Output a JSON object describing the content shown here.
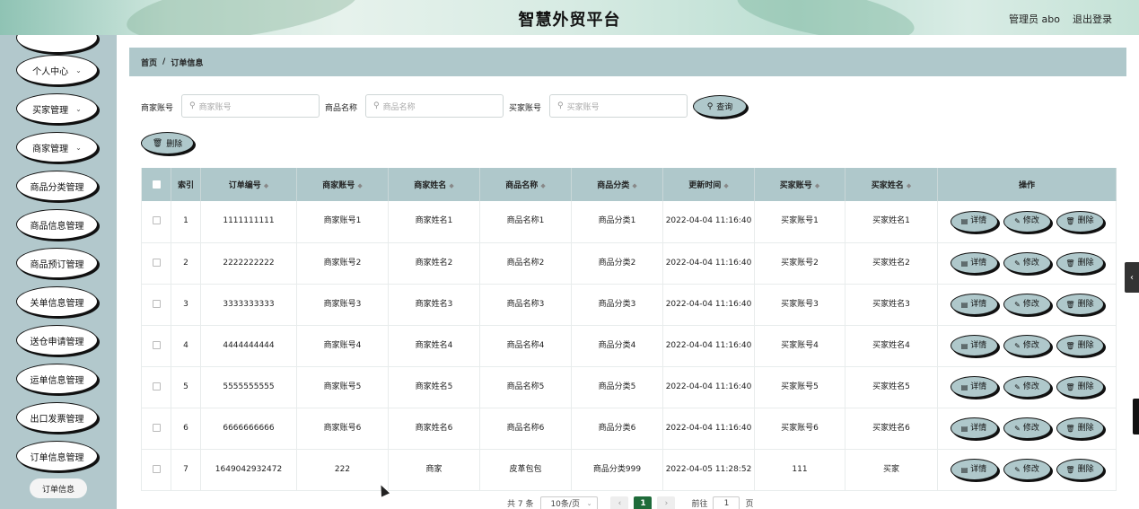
{
  "header": {
    "title": "智慧外贸平台",
    "user": "管理员 abo",
    "logout": "退出登录"
  },
  "sidebar": {
    "items": [
      {
        "label": "个人中心",
        "chevron": true
      },
      {
        "label": "买家管理",
        "chevron": true
      },
      {
        "label": "商家管理",
        "chevron": true
      },
      {
        "label": "商品分类管理"
      },
      {
        "label": "商品信息管理"
      },
      {
        "label": "商品预订管理"
      },
      {
        "label": "关单信息管理"
      },
      {
        "label": "送仓申请管理"
      },
      {
        "label": "运单信息管理"
      },
      {
        "label": "出口发票管理"
      },
      {
        "label": "订单信息管理"
      }
    ],
    "sub_item": "订单信息"
  },
  "breadcrumb": {
    "home": "首页",
    "sep": "/",
    "current": "订单信息"
  },
  "search": {
    "merchant_label": "商家账号",
    "merchant_placeholder": "商家账号",
    "product_label": "商品名称",
    "product_placeholder": "商品名称",
    "buyer_label": "买家账号",
    "buyer_placeholder": "买家账号",
    "query_button": "查询"
  },
  "toolbar": {
    "delete_button": "删除"
  },
  "table": {
    "columns": [
      "索引",
      "订单编号",
      "商家账号",
      "商家姓名",
      "商品名称",
      "商品分类",
      "更新时间",
      "买家账号",
      "买家姓名",
      "操作"
    ],
    "rows": [
      {
        "idx": "1",
        "order_no": "1111111111",
        "merchant_acc": "商家账号1",
        "merchant_name": "商家姓名1",
        "product": "商品名称1",
        "category": "商品分类1",
        "time": "2022-04-04 11:16:40",
        "buyer_acc": "买家账号1",
        "buyer_name": "买家姓名1"
      },
      {
        "idx": "2",
        "order_no": "2222222222",
        "merchant_acc": "商家账号2",
        "merchant_name": "商家姓名2",
        "product": "商品名称2",
        "category": "商品分类2",
        "time": "2022-04-04 11:16:40",
        "buyer_acc": "买家账号2",
        "buyer_name": "买家姓名2"
      },
      {
        "idx": "3",
        "order_no": "3333333333",
        "merchant_acc": "商家账号3",
        "merchant_name": "商家姓名3",
        "product": "商品名称3",
        "category": "商品分类3",
        "time": "2022-04-04 11:16:40",
        "buyer_acc": "买家账号3",
        "buyer_name": "买家姓名3"
      },
      {
        "idx": "4",
        "order_no": "4444444444",
        "merchant_acc": "商家账号4",
        "merchant_name": "商家姓名4",
        "product": "商品名称4",
        "category": "商品分类4",
        "time": "2022-04-04 11:16:40",
        "buyer_acc": "买家账号4",
        "buyer_name": "买家姓名4"
      },
      {
        "idx": "5",
        "order_no": "5555555555",
        "merchant_acc": "商家账号5",
        "merchant_name": "商家姓名5",
        "product": "商品名称5",
        "category": "商品分类5",
        "time": "2022-04-04 11:16:40",
        "buyer_acc": "买家账号5",
        "buyer_name": "买家姓名5"
      },
      {
        "idx": "6",
        "order_no": "6666666666",
        "merchant_acc": "商家账号6",
        "merchant_name": "商家姓名6",
        "product": "商品名称6",
        "category": "商品分类6",
        "time": "2022-04-04 11:16:40",
        "buyer_acc": "买家账号6",
        "buyer_name": "买家姓名6"
      },
      {
        "idx": "7",
        "order_no": "1649042932472",
        "merchant_acc": "222",
        "merchant_name": "商家",
        "product": "皮革包包",
        "category": "商品分类999",
        "time": "2022-04-05 11:28:52",
        "buyer_acc": "111",
        "buyer_name": "买家"
      }
    ],
    "actions": {
      "detail": "详情",
      "edit": "修改",
      "delete": "删除"
    }
  },
  "pagination": {
    "total": "共 7 条",
    "page_size": "10条/页",
    "current_page": "1",
    "goto_label": "前往",
    "goto_value": "1",
    "page_suffix": "页"
  },
  "icons": {
    "search": "magnifier-icon",
    "delete": "trash-icon",
    "detail": "document-icon",
    "edit": "pencil-icon"
  },
  "colors": {
    "accent": "#afc8cb",
    "active_page": "#1f6b3a",
    "sidebar": "#b2c8cc"
  }
}
